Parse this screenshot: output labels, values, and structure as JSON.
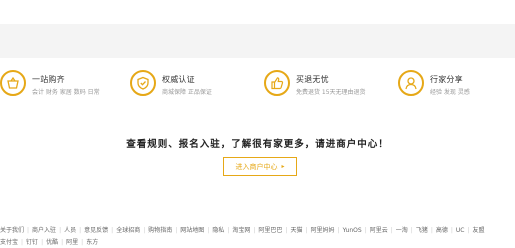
{
  "features": [
    {
      "title": "一站购齐",
      "subtitle": "会计 财务 家居 数码 日常",
      "icon": "basket-icon"
    },
    {
      "title": "权威认证",
      "subtitle": "商城保障 正品保证",
      "icon": "shield-icon"
    },
    {
      "title": "买退无忧",
      "subtitle": "免费退货 15天无理由退货",
      "icon": "thumbs-up-icon"
    },
    {
      "title": "行家分享",
      "subtitle": "经验 发现 灵感",
      "icon": "expert-icon"
    }
  ],
  "slogan": "查看规则、报名入驻，了解很有家更多，请进商户中心！",
  "merchant_button": {
    "label": "进入商户中心",
    "arrow": "▸"
  },
  "footer_links_row1": [
    "关于我们",
    "商户入驻",
    "人员",
    "意见反馈",
    "全球招商",
    "购物指南",
    "网站地图",
    "隐私",
    "淘宝网",
    "阿里巴巴",
    "天猫",
    "阿里妈妈",
    "YunOS",
    "阿里云",
    "一淘",
    "飞猪",
    "高德",
    "UC",
    "友盟"
  ],
  "footer_links_row2": [
    "支付宝",
    "钉钉",
    "优酷",
    "阿里",
    "东方"
  ],
  "colors": {
    "accent": "#e6a817",
    "top_band": "#f4f4f4"
  }
}
